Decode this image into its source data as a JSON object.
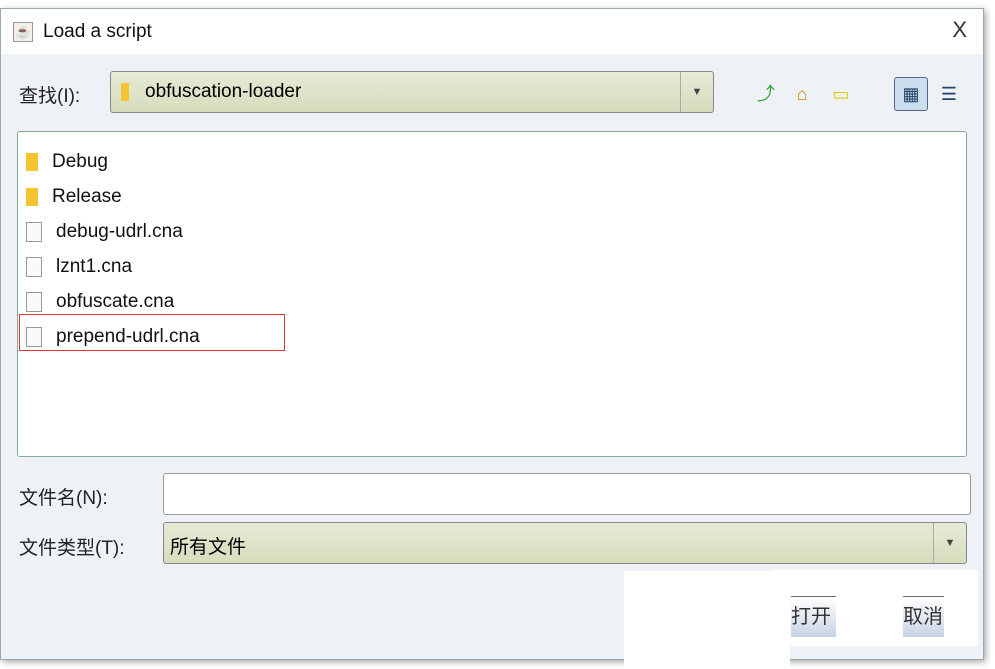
{
  "dialog": {
    "title": "Load a script",
    "close": "X"
  },
  "look_in": {
    "label": "查找(I):",
    "value": "obfuscation-loader"
  },
  "toolbar": {
    "icons": [
      "up-folder-icon",
      "home-icon",
      "new-folder-icon",
      "list-view-icon",
      "details-view-icon"
    ]
  },
  "files": [
    {
      "name": "Debug",
      "type": "folder"
    },
    {
      "name": "Release",
      "type": "folder"
    },
    {
      "name": "debug-udrl.cna",
      "type": "file"
    },
    {
      "name": "lznt1.cna",
      "type": "file"
    },
    {
      "name": "obfuscate.cna",
      "type": "file"
    },
    {
      "name": "prepend-udrl.cna",
      "type": "file",
      "highlighted": true
    }
  ],
  "file_name": {
    "label": "文件名(N):",
    "value": ""
  },
  "file_type": {
    "label": "文件类型(T):",
    "value": "所有文件"
  },
  "buttons": {
    "open": "打开",
    "cancel": "取消"
  },
  "colors": {
    "highlight": "#dd3333",
    "combo": "#dde2c6"
  }
}
